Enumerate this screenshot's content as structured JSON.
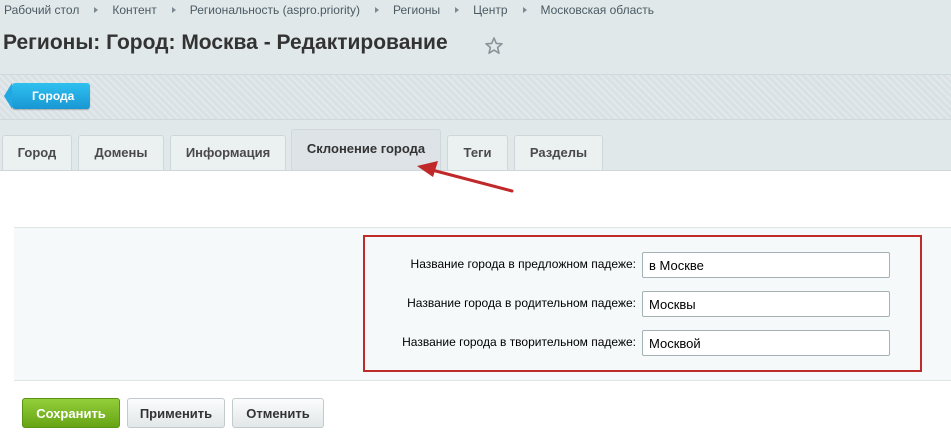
{
  "breadcrumb": [
    {
      "label": "Рабочий стол"
    },
    {
      "label": "Контент"
    },
    {
      "label": "Региональность (aspro.priority)"
    },
    {
      "label": "Регионы"
    },
    {
      "label": "Центр"
    },
    {
      "label": "Московская область"
    }
  ],
  "page": {
    "title": "Регионы: Город: Москва - Редактирование",
    "favorite_icon": "star-icon"
  },
  "context": {
    "button_label": "Города"
  },
  "tabs": [
    {
      "label": "Город"
    },
    {
      "label": "Домены"
    },
    {
      "label": "Информация"
    },
    {
      "label": "Склонение города",
      "active": true
    },
    {
      "label": "Теги"
    },
    {
      "label": "Разделы"
    }
  ],
  "form": {
    "fields": [
      {
        "label": "Название города в предложном падеже:",
        "value": "в Москве"
      },
      {
        "label": "Название города в родительном падеже:",
        "value": "Москвы"
      },
      {
        "label": "Название города в творительном падеже:",
        "value": "Москвой"
      }
    ]
  },
  "actions": {
    "save_label": "Сохранить",
    "apply_label": "Применить",
    "cancel_label": "Отменить"
  },
  "colors": {
    "highlight": "#bd2b2b",
    "save_button": "#7bbb24",
    "context_button": "#22a9e3"
  }
}
